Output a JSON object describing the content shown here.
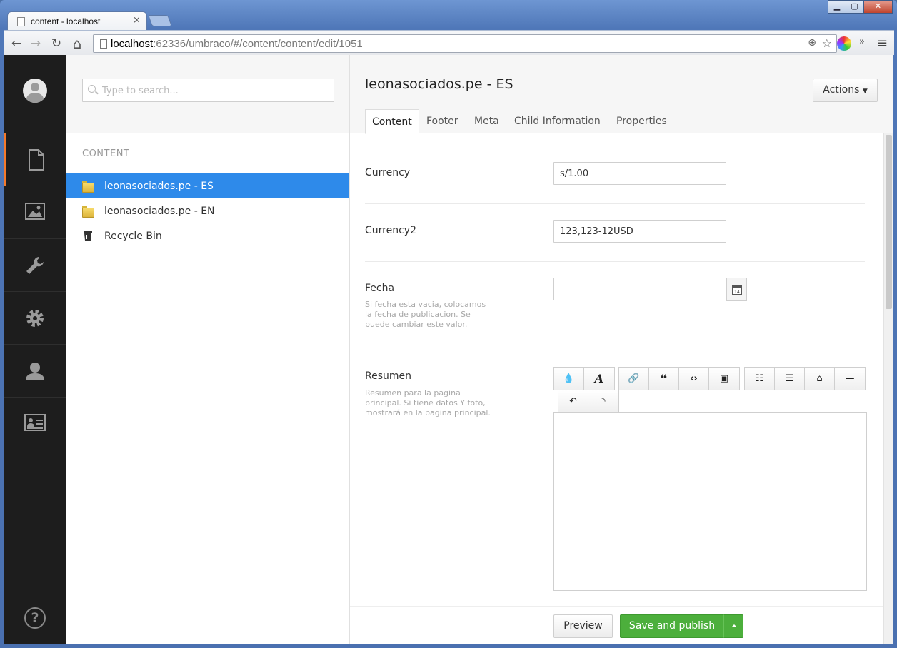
{
  "browser": {
    "tab_title": "content - localhost",
    "tab_close": "×",
    "url_host": "localhost",
    "url_rest": ":62336/umbraco/#/content/content/edit/1051",
    "controls": {
      "minimize": "▁",
      "maximize": "▢",
      "close": "✕"
    },
    "nav": {
      "back": "←",
      "forward": "→",
      "reload": "↻",
      "home": "⌂"
    }
  },
  "sidebar": {
    "sections": [
      "content-icon",
      "media-icon",
      "developer-icon",
      "settings-icon",
      "users-icon",
      "members-icon"
    ],
    "active": "content-icon",
    "help": "?"
  },
  "tree": {
    "search_placeholder": "Type to search...",
    "section_label": "CONTENT",
    "nodes": [
      {
        "label": "leonasociados.pe - ES",
        "icon": "folder-icon",
        "selected": true
      },
      {
        "label": "leonasociados.pe - EN",
        "icon": "folder-icon",
        "selected": false
      },
      {
        "label": "Recycle Bin",
        "icon": "trash-icon",
        "selected": false
      }
    ]
  },
  "editor": {
    "node_name": "leonasociados.pe - ES",
    "actions_label": "Actions",
    "tabs": [
      "Content",
      "Footer",
      "Meta",
      "Child Information",
      "Properties"
    ],
    "active_tab": "Content",
    "properties": {
      "currency": {
        "label": "Currency",
        "value": "s/1.00"
      },
      "currency2": {
        "label": "Currency2",
        "value": "123,123-12USD"
      },
      "fecha": {
        "label": "Fecha",
        "description": "Si fecha esta vacia, colocamos la fecha de publicacion. Se puede cambiar este valor.",
        "value": "",
        "calendar_day": "14"
      },
      "resumen": {
        "label": "Resumen",
        "description": "Resumen para la pagina principal. Si tiene datos Y foto, mostrará en la pagina principal."
      }
    },
    "footer": {
      "preview_label": "Preview",
      "save_label": "Save and publish"
    }
  },
  "colors": {
    "sidebar_bg": "#1d1d1d",
    "active_accent": "#f5792a",
    "selected_node": "#2e8aea",
    "save_button": "#4caf3c"
  }
}
